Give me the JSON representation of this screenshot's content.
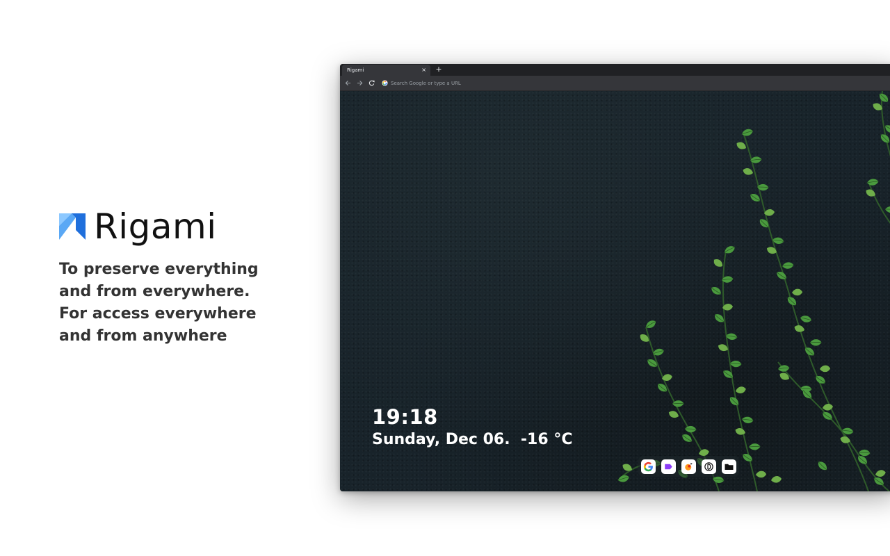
{
  "hero": {
    "brand_name": "Rigami",
    "tagline": "To preserve everything and from everywhere. For access everywhere and from anywhere"
  },
  "browser": {
    "tab_title": "Rigami",
    "tab_close": "×",
    "new_tab": "+",
    "omnibox_placeholder": "Search Google or type a URL"
  },
  "newtab": {
    "time": "19:18",
    "date_weather": "Sunday, Dec 06.  -16 °C",
    "dock_items": [
      {
        "icon": "google-icon"
      },
      {
        "icon": "purple-tag-icon"
      },
      {
        "icon": "orange-app-icon"
      },
      {
        "icon": "dribbble-like-icon"
      },
      {
        "icon": "folder-icon"
      }
    ]
  },
  "colors": {
    "logo_light": "#5aa8f5",
    "logo_dark": "#1f6fdc",
    "wallpaper": "#18232a",
    "vine_leaf": "#3f8a3a"
  }
}
